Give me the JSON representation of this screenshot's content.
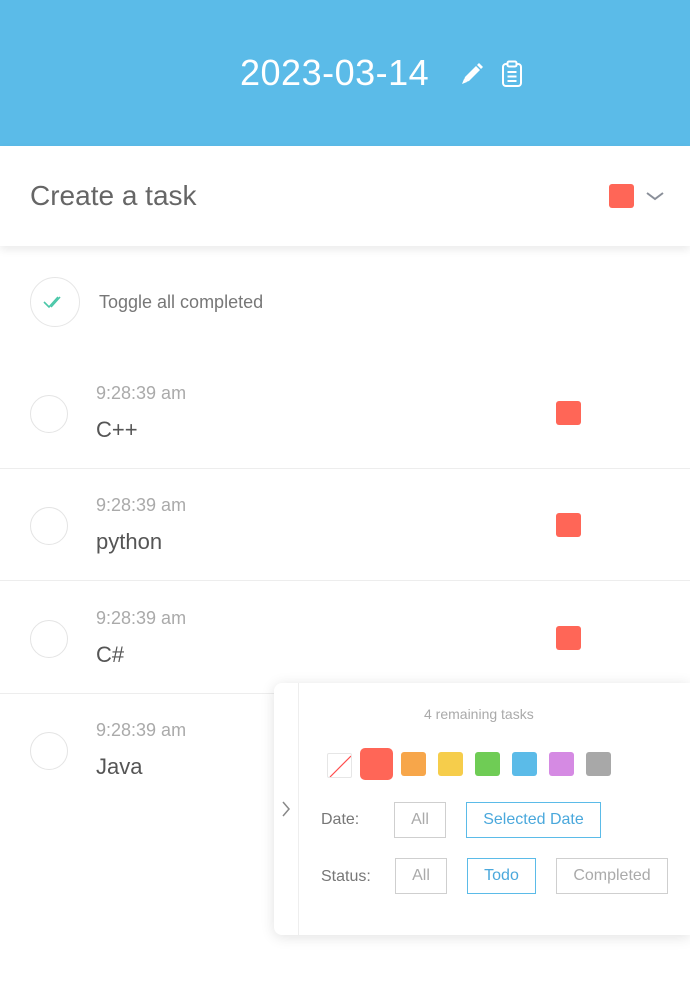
{
  "header": {
    "date": "2023-03-14",
    "edit_icon": "pen-icon",
    "clipboard_icon": "clipboard-icon",
    "background": "#5bbbe8"
  },
  "create_task": {
    "placeholder": "Create a task",
    "selected_color": "#ff6657",
    "dropdown_icon": "chevron-down-icon"
  },
  "toggle_all": {
    "label": "Toggle all completed",
    "icon": "double-check-icon"
  },
  "tasks": [
    {
      "time": "9:28:39 am",
      "title": "C++",
      "color": "#ff6657"
    },
    {
      "time": "9:28:39 am",
      "title": "python",
      "color": "#ff6657"
    },
    {
      "time": "9:28:39 am",
      "title": "C#",
      "color": "#ff6657"
    },
    {
      "time": "9:28:39 am",
      "title": "Java",
      "color": "#ff6657"
    }
  ],
  "filter_panel": {
    "remaining": "4 remaining tasks",
    "collapse_icon": "chevron-right-icon",
    "colors": [
      "none",
      "#ff6657",
      "#f7a64a",
      "#f6cd4b",
      "#6fcc55",
      "#5bbbe8",
      "#d58ae3",
      "#a8a8a8"
    ],
    "selected_color": "#ff6657",
    "date_label": "Date:",
    "date_options": [
      "All",
      "Selected Date"
    ],
    "date_selected": "Selected Date",
    "status_label": "Status:",
    "status_options": [
      "All",
      "Todo",
      "Completed"
    ],
    "status_selected": "Todo"
  }
}
